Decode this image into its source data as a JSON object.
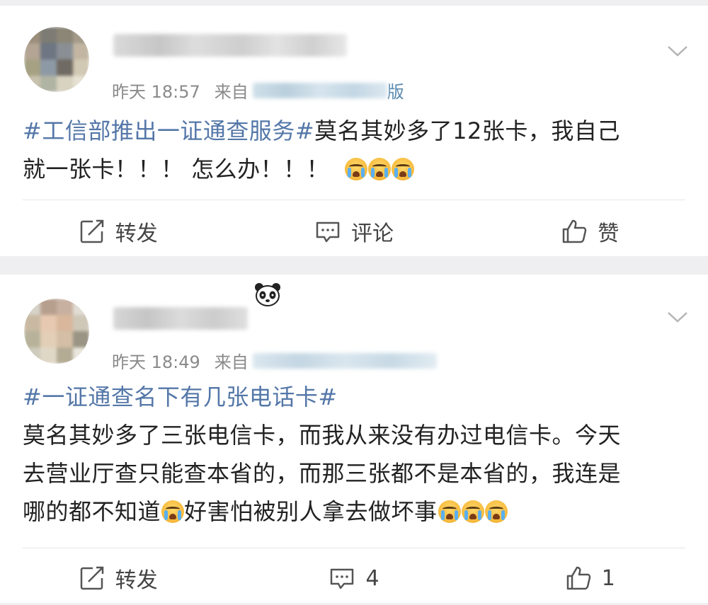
{
  "posts": [
    {
      "time": "昨天 18:57",
      "from_label": "来自",
      "from_suffix": "版",
      "topic": "#工信部推出一证通查服务#",
      "body_line1_rest": "莫名其妙多了12张卡，我自己",
      "body_line2": "就一张卡！！！ 怎么办！！！",
      "emoji_count": 3,
      "actions": {
        "repost": "转发",
        "comment": "评论",
        "like": "赞"
      }
    },
    {
      "time": "昨天 18:49",
      "from_label": "来自",
      "topic": "#一证通查名下有几张电话卡#",
      "body_line1": "莫名其妙多了三张电信卡，而我从来没有办过电信卡。今天",
      "body_line2": "去营业厅查只能查本省的，而那三张都不是本省的，我连是",
      "body_line3a": "哪的都不知道",
      "body_line3b": "好害怕被别人拿去做坏事",
      "actions": {
        "repost": "转发",
        "comment": "4",
        "like": "1"
      }
    }
  ],
  "colors": {
    "topic": "#5477a8",
    "background": "#efeff1",
    "meta": "#8a8a8a"
  },
  "icons": [
    "avatar",
    "chevron-down-icon",
    "repost-icon",
    "comment-icon",
    "like-icon",
    "crying-emoji",
    "panda-emoji"
  ]
}
